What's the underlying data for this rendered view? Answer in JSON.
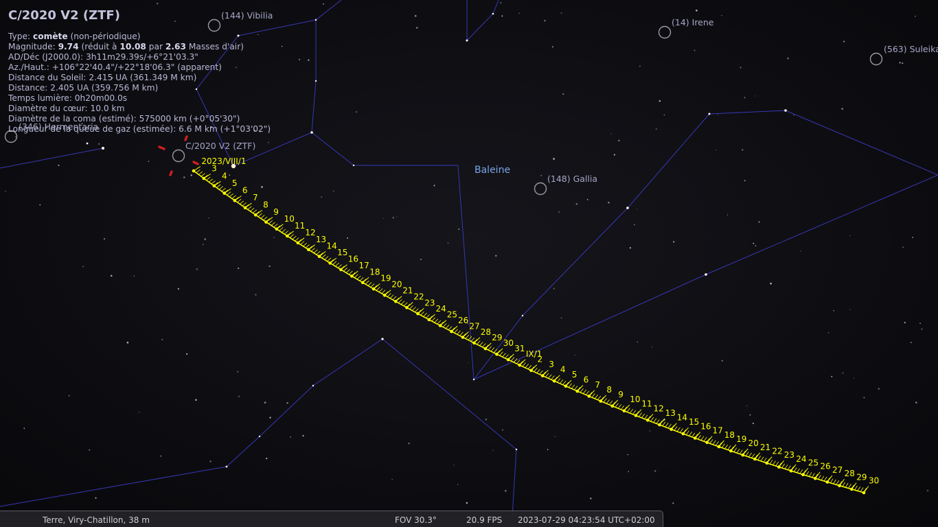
{
  "object_info": {
    "title": "C/2020 V2 (ZTF)",
    "type_label": "Type: ",
    "type_value": "comète",
    "type_suffix": " (non-périodique)",
    "mag_label": "Magnitude: ",
    "mag_value": "9.74",
    "mag_mid1": " (réduit à ",
    "mag_reduced": "10.08",
    "mag_mid2": " par ",
    "mag_airmass": "2.63",
    "mag_suffix": " Masses d'air)",
    "radec": "AD/Déc (J2000.0): 3h11m29.39s/+6°21'03.3\"",
    "azalt": "Az./Haut.: +106°22'40.4\"/+22°18'06.3\" (apparent)",
    "sun_distance": "Distance du Soleil: 2.415 UA (361.349 M km)",
    "distance": "Distance: 2.405 UA (359.756 M km)",
    "light_time": "Temps lumière: 0h20m00.0s",
    "core_diameter": "Diamètre du cœur: 10.0 km",
    "coma_diameter": "Diamètre de la coma (estimé): 575000 km (+0°05'30\")",
    "tail_length": "Longueur de la queue de gaz (estimée): 6.6 M km (+1°03'02\")"
  },
  "sky_labels": {
    "constellation": "Baleine",
    "selected_object": "C/2020 V2 (ZTF)",
    "asteroids": [
      "(144) Vibilia",
      "(14) Irene",
      "(563) Suleika",
      "(148) Gallia",
      "(346) Hermentaria"
    ]
  },
  "trajectory": {
    "august_labels": [
      "2023/VIII/1",
      "3",
      "4",
      "5",
      "6",
      "7",
      "8",
      "9",
      "10",
      "11",
      "12",
      "13",
      "14",
      "15",
      "16",
      "17",
      "18",
      "19",
      "20",
      "21",
      "22",
      "23",
      "24",
      "25",
      "26",
      "27",
      "28",
      "29",
      "30",
      "31"
    ],
    "september_labels": [
      "IX/1",
      "2",
      "3",
      "4",
      "5",
      "6",
      "7",
      "8",
      "9",
      "10",
      "11",
      "12",
      "13",
      "14",
      "15",
      "16",
      "17",
      "18",
      "19",
      "20",
      "21",
      "22",
      "23",
      "24",
      "25",
      "26",
      "27",
      "28",
      "29",
      "30"
    ]
  },
  "status_bar": {
    "location": "Terre, Viry-Chatillon, 38 m",
    "fov": "FOV 30.3°",
    "fps": "20.9 FPS",
    "datetime": "2023-07-29 04:23:54 UTC+02:00"
  },
  "colors": {
    "background": "#000000",
    "constellation_lines": "#3c3cc8",
    "trajectory": "#ffff00",
    "pointer": "#e02020",
    "info_text": "#b8b8d6",
    "constellation_label": "#7aa6e8"
  }
}
